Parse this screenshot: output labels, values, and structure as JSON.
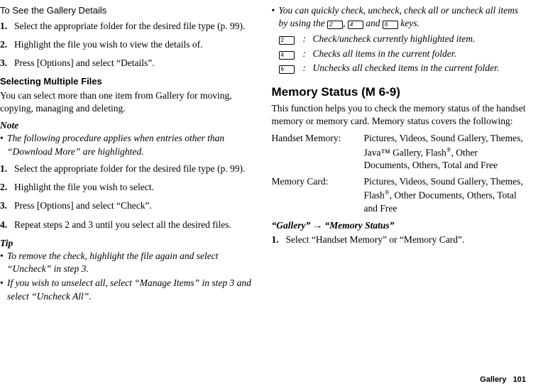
{
  "left": {
    "heading1": "To See the Gallery Details",
    "steps1": [
      "Select the appropriate folder for the desired file type (p. 99).",
      "Highlight the file you wish to view the details of.",
      "Press [Options] and select “Details”."
    ],
    "heading2": "Selecting Multiple Files",
    "para2": "You can select more than one item from Gallery for moving, copying, managing and deleting.",
    "note_label": "Note",
    "note_bullet": "The following procedure applies when entries other than “Download More” are highlighted.",
    "steps2": [
      "Select the appropriate folder for the desired file type (p. 99).",
      "Highlight the file you wish to select.",
      "Press [Options] and select “Check”.",
      "Repeat steps 2 and 3 until you select all the desired files."
    ],
    "tip_label": "Tip",
    "tip1": "To remove the check, highlight the file again and select “Uncheck” in step 3.",
    "tip2": "If you wish to unselect all, select “Manage Items” in step 3 and select “Uncheck All”."
  },
  "right": {
    "top_prefix": "You can quickly check, uncheck, check all or uncheck all items by using the ",
    "top_mid1": ", ",
    "top_mid2": " and ",
    "top_suffix": " keys.",
    "key_labels": {
      "k2": "2",
      "k4": "4",
      "k6": "6"
    },
    "key_rows": [
      {
        "key": "2",
        "desc": "Check/uncheck currently highlighted item."
      },
      {
        "key": "4",
        "desc": "Checks all items in the current folder."
      },
      {
        "key": "6",
        "desc": "Unchecks all checked items in the current folder."
      }
    ],
    "heading": "Memory Status ",
    "menu_code": "(M 6-9)",
    "intro": "This function helps you to check the memory status of the handset memory or memory card. Memory status covers the following:",
    "rows": {
      "handset_label": "Handset Memory:",
      "handset_val_1": "Pictures, Videos, Sound Gallery, Themes, Java™ Gallery, Flash",
      "handset_val_2": ", Other Documents, Others, Total and Free",
      "card_label": "Memory Card:",
      "card_val_1": "Pictures, Videos, Sound Gallery, Themes, Flash",
      "card_val_2": ", Other Documents, Others, Total and Free"
    },
    "reg": "®",
    "nav": "“Gallery” → “Memory Status”",
    "step": "Select “Handset Memory” or “Memory Card”."
  },
  "footer": {
    "section": "Gallery",
    "page": "101"
  }
}
